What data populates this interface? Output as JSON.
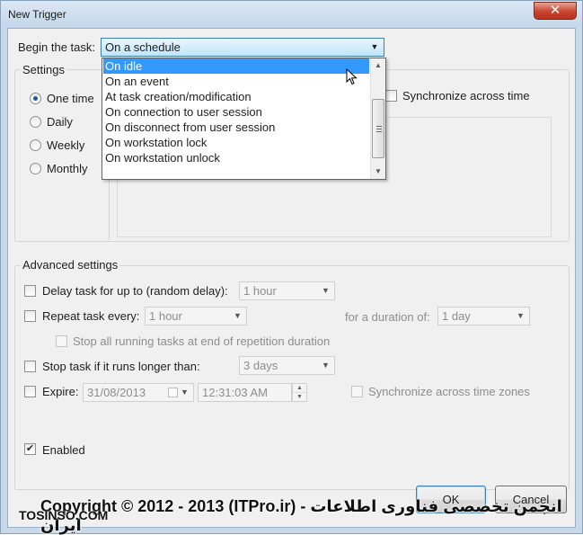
{
  "window": {
    "title": "New Trigger",
    "close_glyph": "✕"
  },
  "begin": {
    "label": "Begin the task:",
    "selected": "On a schedule",
    "options": [
      "On idle",
      "On an event",
      "At task creation/modification",
      "On connection to user session",
      "On disconnect from user session",
      "On workstation lock",
      "On workstation unlock"
    ],
    "highlighted": "On idle"
  },
  "settings": {
    "legend": "Settings",
    "radios": [
      {
        "label": "One time",
        "checked": true
      },
      {
        "label": "Daily",
        "checked": false
      },
      {
        "label": "Weekly",
        "checked": false
      },
      {
        "label": "Monthly",
        "checked": false
      }
    ],
    "sync_label": "Synchronize across time"
  },
  "advanced": {
    "legend": "Advanced settings",
    "delay_label": "Delay task for up to (random delay):",
    "delay_value": "1 hour",
    "repeat_label": "Repeat task every:",
    "repeat_value": "1 hour",
    "duration_label": "for a duration of:",
    "duration_value": "1 day",
    "stop_all_label": "Stop all running tasks at end of repetition duration",
    "stop_longer_label": "Stop task if it runs longer than:",
    "stop_longer_value": "3 days",
    "expire_label": "Expire:",
    "expire_date": "31/08/2013",
    "expire_time": "12:31:03 AM",
    "sync_zones_label": "Synchronize across time zones",
    "enabled_label": "Enabled",
    "enabled_checked": true
  },
  "buttons": {
    "ok": "OK",
    "cancel": "Cancel"
  },
  "watermark": {
    "line1": "Copyright © 2012 - 2013 (ITPro.ir) - انجمن تخصصی فناوری اطلاعات ایران",
    "line2": "TOSINSO.COM"
  }
}
